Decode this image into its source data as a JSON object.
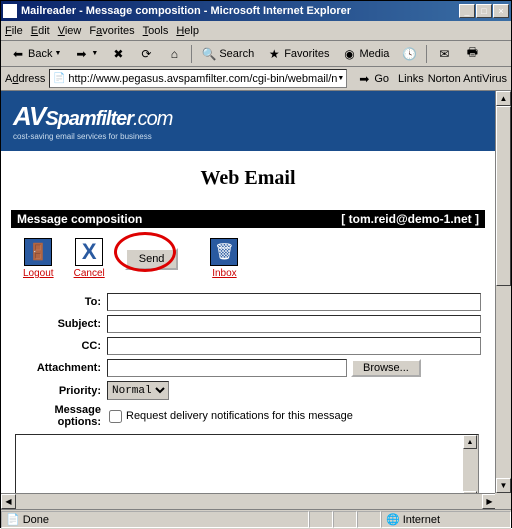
{
  "window": {
    "title": "Mailreader - Message composition - Microsoft Internet Explorer",
    "min": "_",
    "max": "□",
    "close": "×"
  },
  "menubar": [
    "File",
    "Edit",
    "View",
    "Favorites",
    "Tools",
    "Help"
  ],
  "toolbar": {
    "back": "Back",
    "search": "Search",
    "favorites": "Favorites",
    "media": "Media"
  },
  "addressbar": {
    "label": "Address",
    "url": "http://www.pegasus.avspamfilter.com/cgi-bin/webmail/nph-mr.cgi?do=c",
    "go": "Go",
    "links": "Links",
    "norton": "Norton AntiVirus"
  },
  "banner": {
    "logo_av": "AV",
    "logo_main": "Spamfilter",
    "logo_tld": ".com",
    "tagline": "cost-saving email services for business"
  },
  "page_title": "Web Email",
  "section": {
    "title": "Message composition",
    "user": "[ tom.reid@demo-1.net ]"
  },
  "actions": {
    "logout": "Logout",
    "cancel": "Cancel",
    "send": "Send",
    "inbox": "Inbox"
  },
  "form": {
    "to_label": "To:",
    "subject_label": "Subject:",
    "cc_label": "CC:",
    "attachment_label": "Attachment:",
    "browse": "Browse...",
    "priority_label": "Priority:",
    "priority_value": "Normal",
    "options_label": "Message options:",
    "delivery_notif": "Request delivery notifications for this message"
  },
  "statusbar": {
    "status": "Done",
    "zone": "Internet"
  }
}
